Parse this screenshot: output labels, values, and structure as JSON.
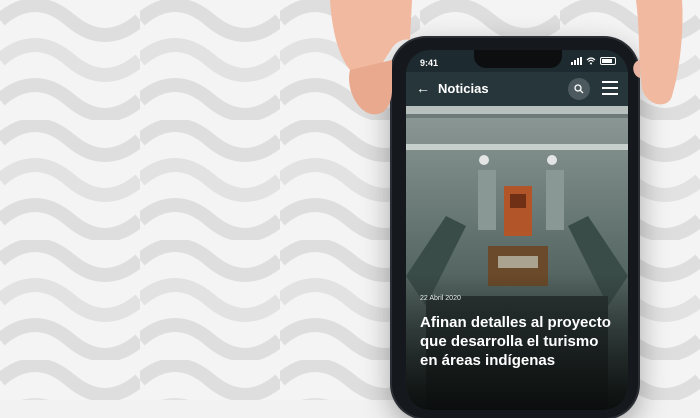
{
  "status_bar": {
    "time": "9:41"
  },
  "app_bar": {
    "title": "Noticias",
    "icons": [
      "back-arrow-icon",
      "search-icon",
      "hamburger-menu-icon"
    ]
  },
  "article": {
    "date": "22 Abril 2020",
    "title": "Afinan detalles al proyecto que desarrolla el turismo en áreas indígenas"
  },
  "colors": {
    "appbar": "#27363b",
    "text": "#ffffff",
    "background": "#f2f2f2"
  }
}
